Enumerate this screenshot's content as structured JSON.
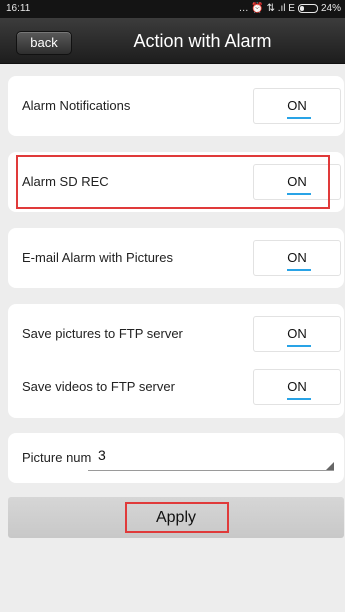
{
  "statusbar": {
    "time": "16:11",
    "icons_text": "… ⏰ ⇅ .ıl E",
    "battery": "24%"
  },
  "navbar": {
    "back_label": "back",
    "title": "Action with Alarm"
  },
  "settings": [
    {
      "label": "Alarm Notifications",
      "toggle": "ON"
    },
    {
      "label": "Alarm SD REC",
      "toggle": "ON"
    },
    {
      "label": "E-mail Alarm with Pictures",
      "toggle": "ON"
    },
    {
      "label": "Save pictures to FTP server",
      "toggle": "ON"
    },
    {
      "label": "Save videos to FTP server",
      "toggle": "ON"
    }
  ],
  "picture_num": {
    "label": "Picture num",
    "value": "3"
  },
  "apply_label": "Apply",
  "colors": {
    "accent": "#29a3e6",
    "highlight": "#e03a3a",
    "navbar": "#2a2a2a",
    "background": "#ededed"
  }
}
